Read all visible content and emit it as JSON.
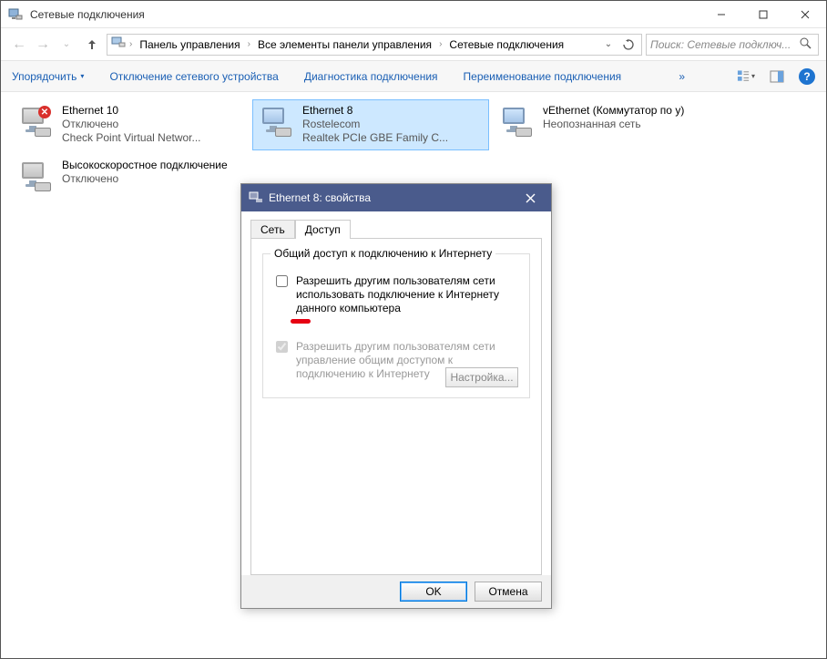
{
  "window": {
    "title": "Сетевые подключения"
  },
  "breadcrumbs": {
    "items": [
      "Панель управления",
      "Все элементы панели управления",
      "Сетевые подключения"
    ]
  },
  "search": {
    "placeholder": "Поиск: Сетевые подключ..."
  },
  "toolbar": {
    "organize": "Упорядочить",
    "disable": "Отключение сетевого устройства",
    "diagnose": "Диагностика подключения",
    "rename": "Переименование подключения"
  },
  "connections": [
    {
      "name": "Ethernet 10",
      "status": "Отключено",
      "detail": "Check Point Virtual Networ...",
      "disabled": true
    },
    {
      "name": "Ethernet 8",
      "status": "Rostelecom",
      "detail": "Realtek PCIe GBE Family C...",
      "selected": true
    },
    {
      "name": "vEthernet (Коммутатор по у)",
      "status": "Неопознанная сеть",
      "detail": ""
    },
    {
      "name": "Высокоскоростное подключение",
      "status": "Отключено",
      "detail": "",
      "disabled": true
    }
  ],
  "dialog": {
    "title": "Ethernet 8: свойства",
    "tabs": {
      "network": "Сеть",
      "access": "Доступ"
    },
    "group_legend": "Общий доступ к подключению к Интернету",
    "chk1": "Разрешить другим пользователям сети использовать подключение к Интернету данного компьютера",
    "chk2": "Разрешить другим пользователям сети управление общим доступом к подключению к Интернету",
    "settings_btn": "Настройка...",
    "ok": "OK",
    "cancel": "Отмена"
  }
}
